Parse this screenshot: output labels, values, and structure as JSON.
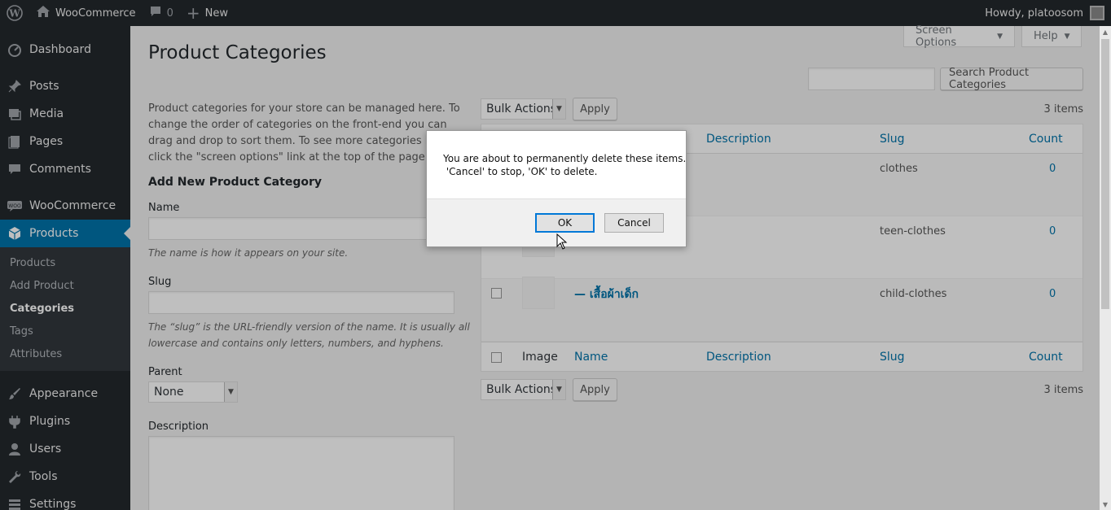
{
  "adminbar": {
    "site_name": "WooCommerce",
    "comments_count": "0",
    "new_label": "New",
    "greeting": "Howdy, platoosom"
  },
  "sidebar": {
    "items": [
      {
        "label": "Dashboard",
        "icon": "dashboard-icon"
      },
      {
        "label": "Posts",
        "icon": "pin-icon"
      },
      {
        "label": "Media",
        "icon": "media-icon"
      },
      {
        "label": "Pages",
        "icon": "page-icon"
      },
      {
        "label": "Comments",
        "icon": "comment-icon"
      },
      {
        "label": "WooCommerce",
        "icon": "woo-icon"
      },
      {
        "label": "Products",
        "icon": "box-icon"
      },
      {
        "label": "Appearance",
        "icon": "brush-icon"
      },
      {
        "label": "Plugins",
        "icon": "plug-icon"
      },
      {
        "label": "Users",
        "icon": "user-icon"
      },
      {
        "label": "Tools",
        "icon": "wrench-icon"
      },
      {
        "label": "Settings",
        "icon": "settings-icon"
      }
    ],
    "submenu": [
      "Products",
      "Add Product",
      "Categories",
      "Tags",
      "Attributes"
    ]
  },
  "screen_options": "Screen Options",
  "help": "Help",
  "page_title": "Product Categories",
  "search": {
    "button": "Search Product Categories",
    "value": ""
  },
  "intro": "Product categories for your store can be managed here. To change the order of categories on the front-end you can drag and drop to sort them. To see more categories listed click the \"screen options\" link at the top of the page.",
  "form": {
    "heading": "Add New Product Category",
    "name_label": "Name",
    "name_desc": "The name is how it appears on your site.",
    "slug_label": "Slug",
    "slug_desc": "The “slug” is the URL-friendly version of the name. It is usually all lowercase and contains only letters, numbers, and hyphens.",
    "parent_label": "Parent",
    "parent_value": "None",
    "description_label": "Description"
  },
  "table": {
    "bulk_actions": "Bulk Actions",
    "apply": "Apply",
    "items_count": "3 items",
    "columns": {
      "image": "Image",
      "name": "Name",
      "description": "Description",
      "slug": "Slug",
      "count": "Count"
    },
    "rows": [
      {
        "name": "",
        "slug": "clothes",
        "count": "0"
      },
      {
        "name": "",
        "slug": "teen-clothes",
        "count": "0"
      },
      {
        "name": "— เสื้อผ้าเด็ก",
        "slug": "child-clothes",
        "count": "0"
      }
    ]
  },
  "dialog": {
    "message": "You are about to permanently delete these items.\n 'Cancel' to stop, 'OK' to delete.",
    "ok": "OK",
    "cancel": "Cancel"
  }
}
